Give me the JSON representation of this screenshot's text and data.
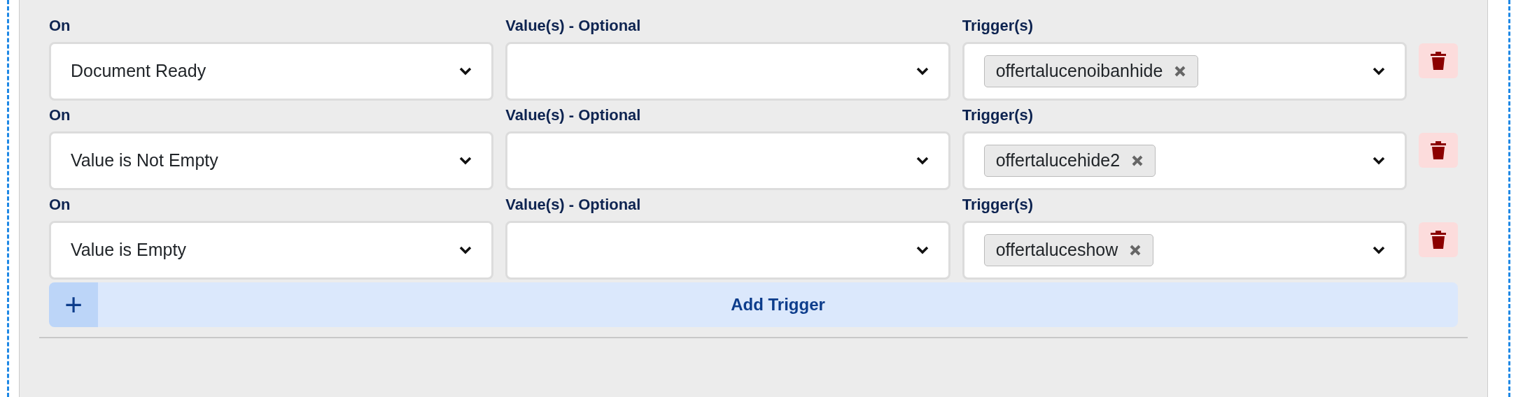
{
  "triggers": [
    {
      "on_label": "On",
      "on_value": "Document Ready",
      "values_label": "Value(s) - Optional",
      "triggers_label": "Trigger(s)",
      "tags": [
        "offertalucenoibanhide"
      ]
    },
    {
      "on_label": "On",
      "on_value": "Value is Not Empty",
      "values_label": "Value(s) - Optional",
      "triggers_label": "Trigger(s)",
      "tags": [
        "offertalucehide2"
      ]
    },
    {
      "on_label": "On",
      "on_value": "Value is Empty",
      "values_label": "Value(s) - Optional",
      "triggers_label": "Trigger(s)",
      "tags": [
        "offertaluceshow"
      ]
    }
  ],
  "add_button": {
    "icon": "+",
    "label": "Add Trigger"
  }
}
